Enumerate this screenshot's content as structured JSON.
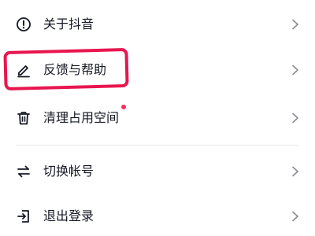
{
  "menu": {
    "items": [
      {
        "label": "关于抖音",
        "icon": "info-circle-icon"
      },
      {
        "label": "反馈与帮助",
        "icon": "pencil-icon"
      },
      {
        "label": "清理占用空间",
        "icon": "trash-icon",
        "badge_color": "#fe2c55"
      },
      {
        "label": "切换帐号",
        "icon": "swap-arrows-icon"
      },
      {
        "label": "退出登录",
        "icon": "logout-icon"
      }
    ],
    "chevron_icon": "chevron-right-icon",
    "highlight_color": "#e8164f"
  }
}
